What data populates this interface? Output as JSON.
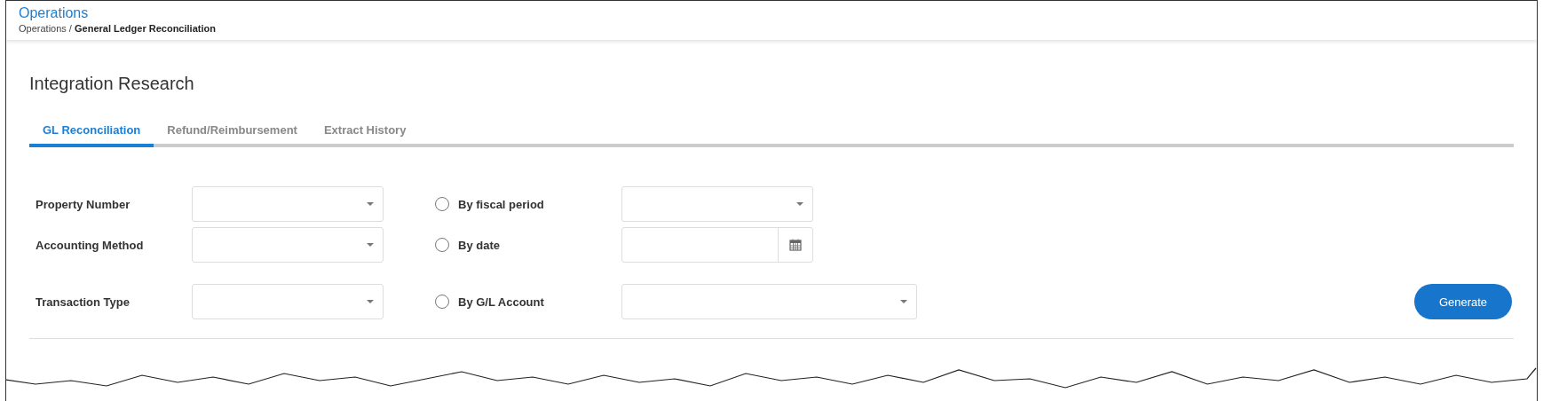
{
  "header": {
    "title": "Operations",
    "breadcrumb": "Operations / **General Ledger Reconciliation**"
  },
  "page_title": "Integration Research",
  "tabs": [
    {
      "label": "GL Reconciliation",
      "selected": true
    },
    {
      "label": "Refund/Reimbursement",
      "selected": false
    },
    {
      "label": "Extract History",
      "selected": false
    }
  ],
  "form_rows": [
    {
      "label": "Property Number",
      "option": {
        "label": "By fiscal period",
        "selected": false,
        "kind": "select",
        "wide": false
      }
    },
    {
      "label": "Accounting Method",
      "option": {
        "label": "By date",
        "selected": false,
        "kind": "date",
        "wide": false
      }
    },
    {
      "label": "Transaction Type",
      "option": {
        "label": "By G/L Account",
        "selected": false,
        "kind": "select",
        "wide": true
      }
    }
  ],
  "generate_button": "Generate"
}
